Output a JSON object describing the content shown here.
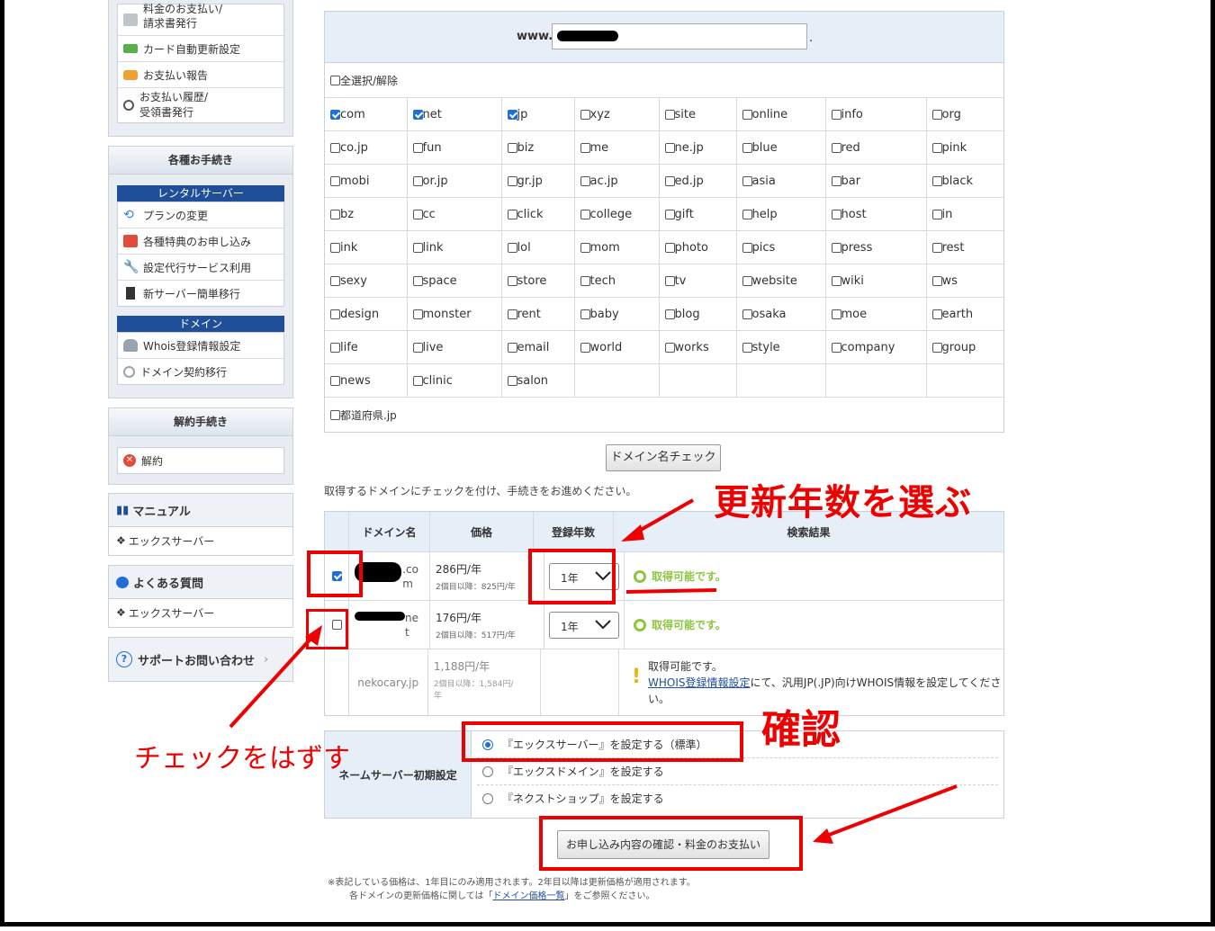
{
  "sidebar": {
    "top_items": [
      "料金のお支払い/\n請求書発行",
      "カード自動更新設定",
      "お支払い報告",
      "お支払い履歴/\n受領書発行"
    ],
    "procedures_title": "各種お手続き",
    "rental_title": "レンタルサーバー",
    "rental_items": [
      "プランの変更",
      "各種特典のお申し込み",
      "設定代行サービス利用",
      "新サーバー簡単移行"
    ],
    "domain_title": "ドメイン",
    "domain_items": [
      "Whois登録情報設定",
      "ドメイン契約移行"
    ],
    "cancel_title": "解約手続き",
    "cancel_item": "解約",
    "manual_title": "マニュアル",
    "manual_item": "エックスサーバー",
    "faq_title": "よくある質問",
    "faq_item": "エックスサーバー",
    "support_title": "サポートお問い合わせ"
  },
  "search": {
    "prefix": "www.",
    "suffix": ".",
    "select_all": "全選択/解除",
    "tlds": [
      [
        "com",
        "net",
        "jp",
        "xyz",
        "site",
        "online",
        "info",
        "org"
      ],
      [
        "co.jp",
        "fun",
        "biz",
        "me",
        "ne.jp",
        "blue",
        "red",
        "pink"
      ],
      [
        "mobi",
        "or.jp",
        "gr.jp",
        "ac.jp",
        "ed.jp",
        "asia",
        "bar",
        "black"
      ],
      [
        "bz",
        "cc",
        "click",
        "college",
        "gift",
        "help",
        "host",
        "in"
      ],
      [
        "ink",
        "link",
        "lol",
        "mom",
        "photo",
        "pics",
        "press",
        "rest"
      ],
      [
        "sexy",
        "space",
        "store",
        "tech",
        "tv",
        "website",
        "wiki",
        "ws"
      ],
      [
        "design",
        "monster",
        "rent",
        "baby",
        "blog",
        "osaka",
        "moe",
        "earth"
      ],
      [
        "life",
        "live",
        "email",
        "world",
        "works",
        "style",
        "company",
        "group"
      ],
      [
        "news",
        "clinic",
        "salon",
        "",
        "",
        "",
        "",
        ""
      ]
    ],
    "checked": [
      "com",
      "net",
      "jp"
    ],
    "prefecture": "都道府県.jp",
    "check_button": "ドメイン名チェック"
  },
  "instructions": "取得するドメインにチェックを付け、手続きをお進めください。",
  "results": {
    "headers": [
      "ドメイン名",
      "価格",
      "登録年数",
      "検索結果"
    ],
    "rows": [
      {
        "checked": true,
        "domain": ".co\nm",
        "price": "286円/年",
        "renew": "2個目以降：825円/年",
        "years": "1年",
        "status": "取得可能です。"
      },
      {
        "checked": false,
        "domain": "ne\nt",
        "price": "176円/年",
        "renew": "2個目以降：517円/年",
        "years": "1年",
        "status": "取得可能です。"
      },
      {
        "checked": false,
        "domain": "nekocary.jp",
        "price": "1,188円/年",
        "renew": "2個目以降：1,584円/\n年",
        "years": "",
        "status_line1": "取得可能です。",
        "status_link": "WHOIS登録情報設定",
        "status_rest": "にて、汎用JP(.JP)向けWHOIS情報を設定してください。"
      }
    ]
  },
  "nameserver": {
    "label": "ネームサーバー初期設定",
    "options": [
      "『エックスサーバー』を設定する（標準）",
      "『エックスドメイン』を設定する",
      "『ネクストショップ』を設定する"
    ],
    "selected": 0
  },
  "submit_button": "お申し込み内容の確認・料金のお支払い",
  "footnote_1": "※表記している価格は、1年目にのみ適用されます。2年目以降は更新価格が適用されます。",
  "footnote_2a": "各ドメインの更新価格に関しては「",
  "footnote_link": "ドメイン価格一覧",
  "footnote_2b": "」をご参照ください。",
  "annotations": {
    "years": "更新年数を選ぶ",
    "confirm": "確認",
    "uncheck": "チェックをはずす",
    "color": "#e00000"
  }
}
